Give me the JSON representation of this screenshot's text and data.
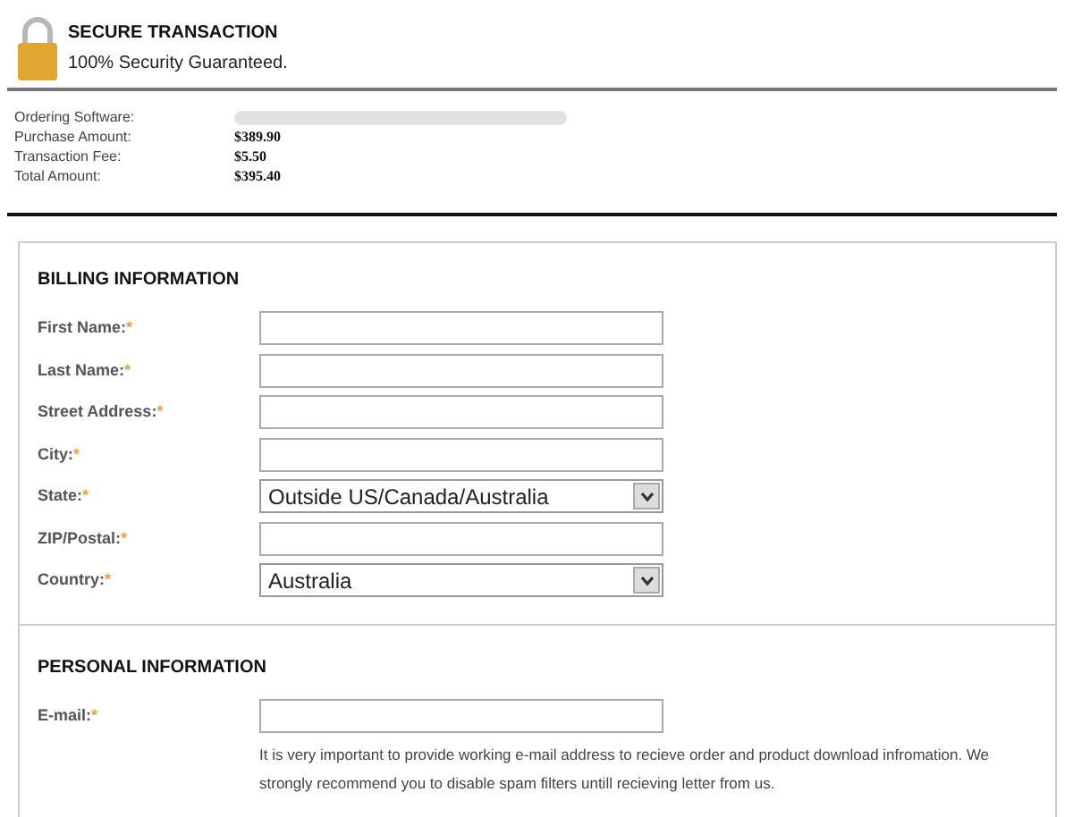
{
  "header": {
    "title": "SECURE TRANSACTION",
    "subtitle": "100% Security Guaranteed."
  },
  "summary": [
    {
      "label": "Ordering Software:",
      "kind": "redacted"
    },
    {
      "label": "Purchase Amount:",
      "kind": "value",
      "value": "$389.90"
    },
    {
      "label": "Transaction Fee:",
      "kind": "value",
      "value": "$5.50"
    },
    {
      "label": "Total Amount:",
      "kind": "value",
      "value": "$395.40"
    }
  ],
  "billing": {
    "title": "BILLING INFORMATION",
    "fields": [
      {
        "label": "First Name:",
        "mark": "*",
        "kind": "text"
      },
      {
        "label": "Last Name:",
        "mark": "*",
        "kind": "text"
      },
      {
        "label": "Street Address:",
        "mark": "*",
        "kind": "text"
      },
      {
        "label": "City:",
        "mark": "*",
        "kind": "text"
      },
      {
        "label": "State:",
        "mark": "*",
        "kind": "select",
        "value": "Outside US/Canada/Australia"
      },
      {
        "label": "ZIP/Postal:",
        "mark": "*",
        "kind": "text"
      },
      {
        "label": "Country:",
        "mark": "*",
        "kind": "select",
        "value": "Australia"
      }
    ]
  },
  "personal": {
    "title": "PERSONAL INFORMATION",
    "fields": [
      {
        "label": "E-mail:",
        "mark": "*",
        "kind": "text",
        "note": "It is very important to provide working e-mail address to recieve order and product download infromation. We strongly recommend you to disable spam filters untill recieving letter from us."
      }
    ]
  }
}
